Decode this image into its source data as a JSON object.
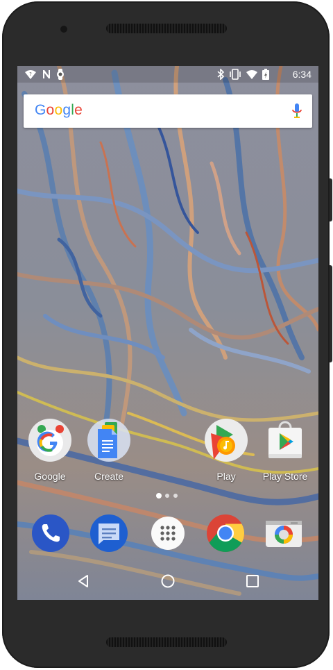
{
  "status_bar": {
    "left_icons": [
      "wifi-question-icon",
      "n-notification-icon",
      "watch-icon"
    ],
    "right_icons": [
      "bluetooth-icon",
      "vibrate-icon",
      "wifi-icon",
      "battery-charging-icon"
    ],
    "time": "6:34"
  },
  "search_bar": {
    "logo_letters": [
      "G",
      "o",
      "o",
      "g",
      "l",
      "e"
    ],
    "logo_colors": [
      "#4285F4",
      "#EA4335",
      "#FBBC05",
      "#4285F4",
      "#34A853",
      "#EA4335"
    ],
    "mic_icon": "mic-icon"
  },
  "home_apps": [
    {
      "label": "Google",
      "icon": "google-folder-icon"
    },
    {
      "label": "Create",
      "icon": "docs-folder-icon"
    },
    {
      "label": "Play",
      "icon": "play-folder-icon"
    },
    {
      "label": "Play Store",
      "icon": "play-store-icon"
    }
  ],
  "page_indicator": {
    "pages": 3,
    "current": 1
  },
  "dock": [
    {
      "name": "Phone",
      "icon": "phone-icon"
    },
    {
      "name": "Messenger",
      "icon": "messenger-icon"
    },
    {
      "name": "All apps",
      "icon": "app-drawer-icon"
    },
    {
      "name": "Chrome",
      "icon": "chrome-icon"
    },
    {
      "name": "Camera",
      "icon": "camera-icon"
    }
  ],
  "navigation": [
    "back-icon",
    "home-icon",
    "recents-icon"
  ],
  "colors": {
    "google_blue": "#4285F4",
    "google_red": "#EA4335",
    "google_yellow": "#FBBC05",
    "google_green": "#34A853",
    "phone_dock": "#2a56c6",
    "device_body": "#2b2b2b"
  }
}
